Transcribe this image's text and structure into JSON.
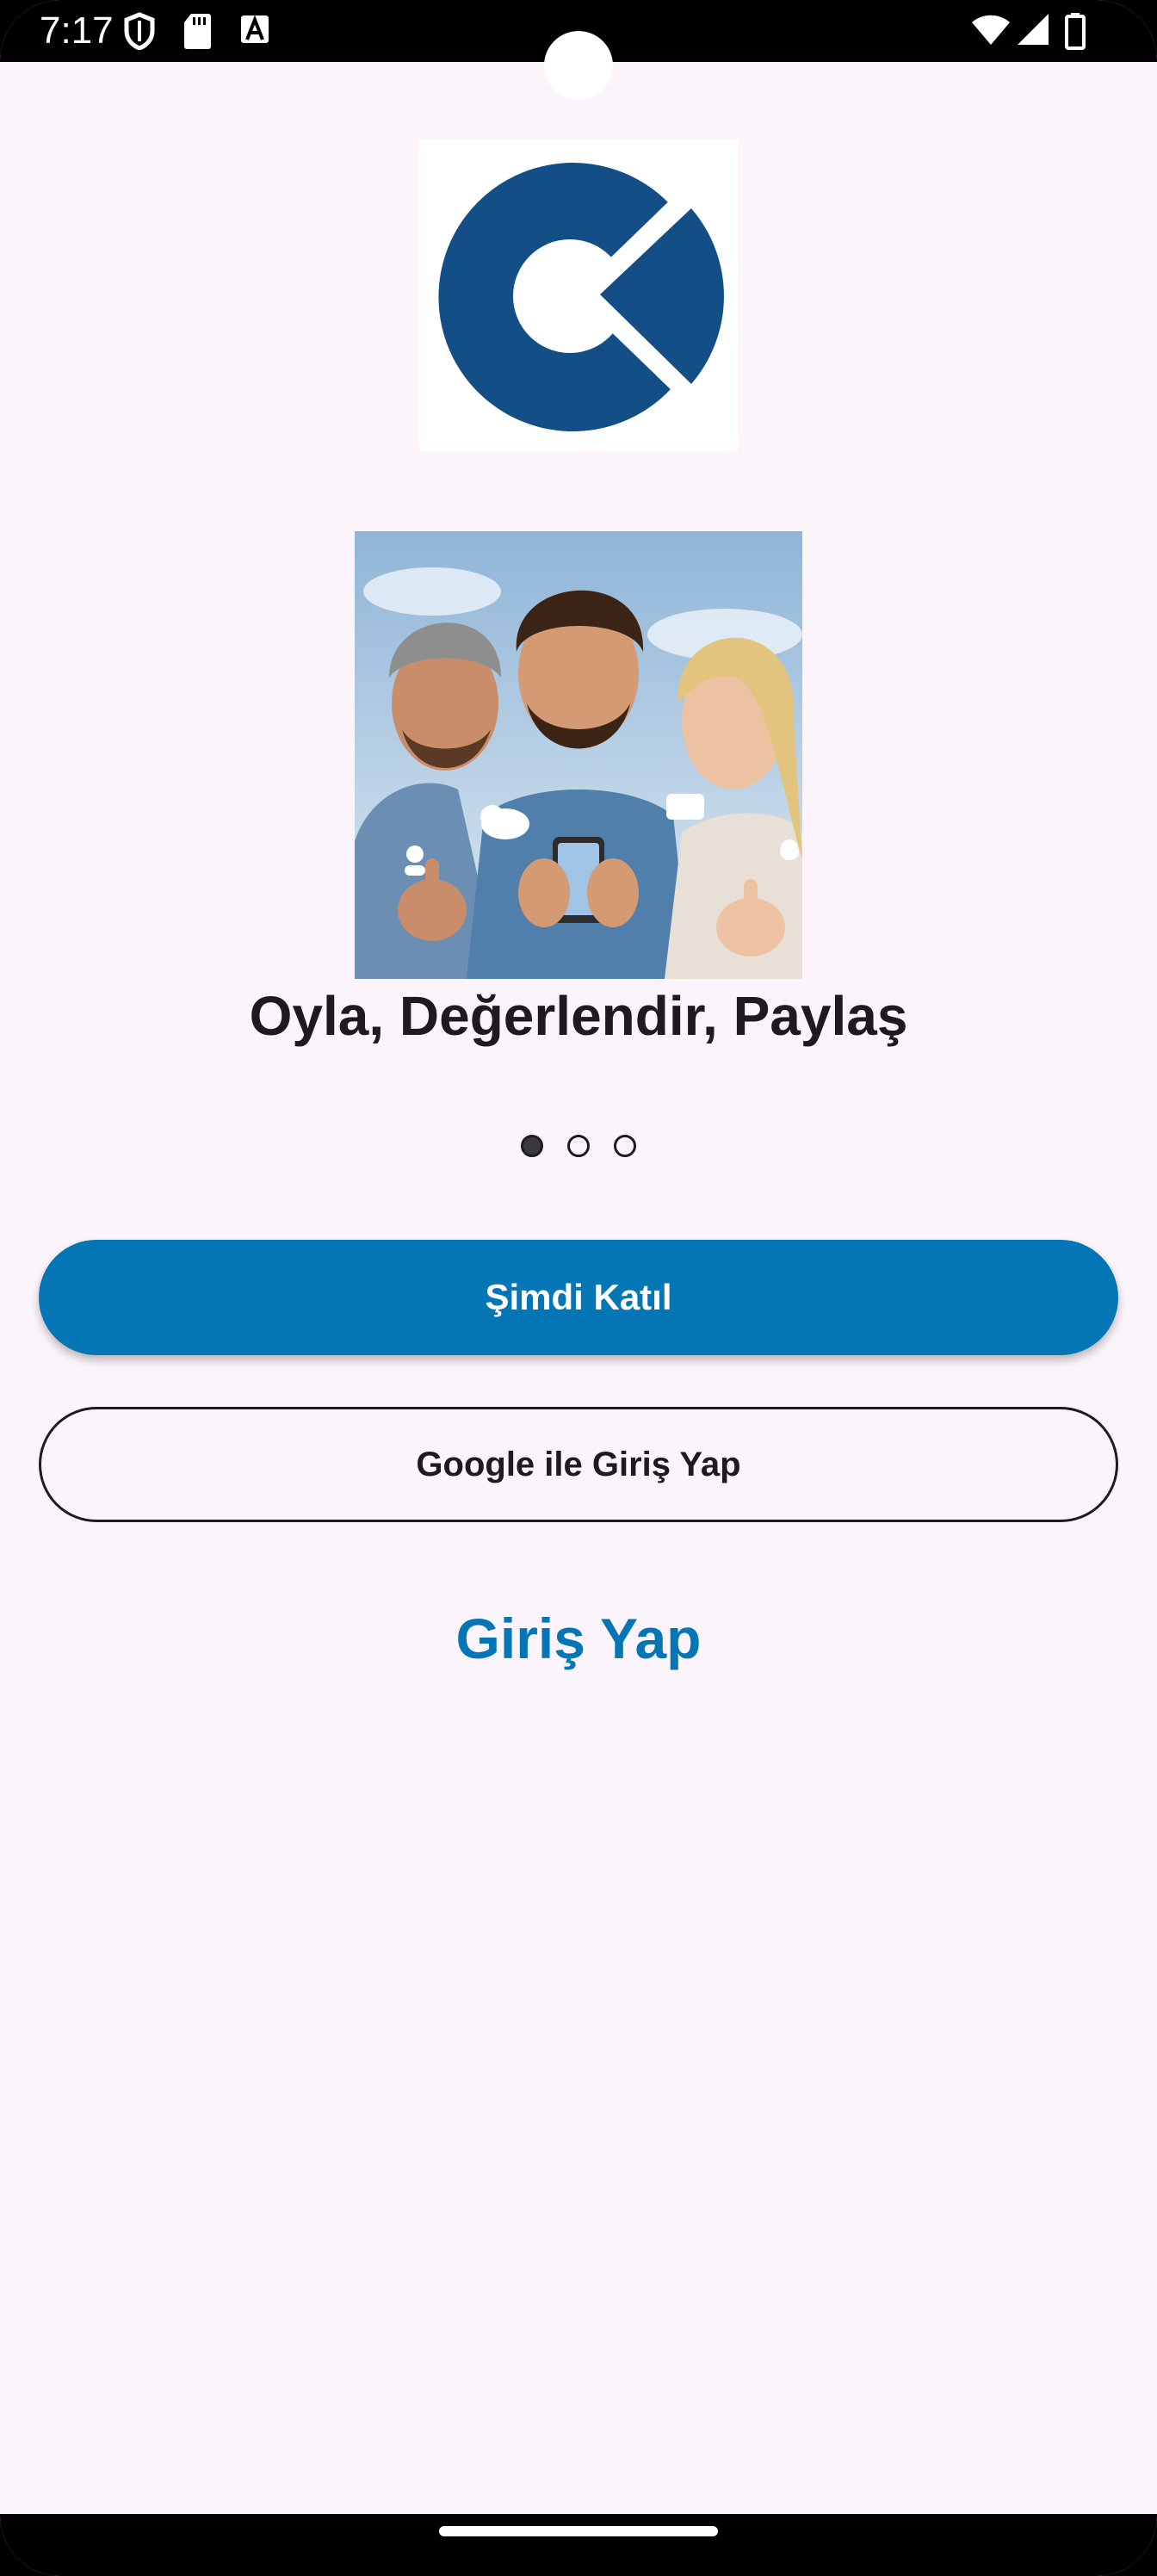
{
  "status_bar": {
    "time": "7:17",
    "icons": [
      "shield-icon",
      "sd-card-icon",
      "font-icon",
      "wifi-icon",
      "signal-icon",
      "battery-icon"
    ]
  },
  "logo": {
    "icon": "app-logo-icon",
    "color": "#134e86"
  },
  "hero": {
    "image": "friends-with-smartphone-illustration",
    "caption": "Oyla, Değerlendir, Paylaş"
  },
  "pager": {
    "count": 3,
    "active_index": 0
  },
  "buttons": {
    "join_label": "Şimdi Katıl",
    "google_label": "Google ile Giriş Yap",
    "login_label": "Giriş Yap"
  },
  "colors": {
    "primary": "#0476b6",
    "background": "#fcf4fb",
    "text": "#1d1b20"
  }
}
